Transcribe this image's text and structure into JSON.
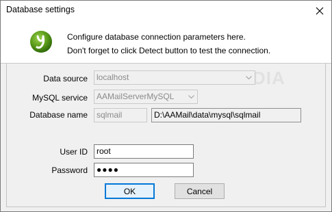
{
  "window": {
    "title": "Database settings"
  },
  "header": {
    "line1": "Configure database connection parameters here.",
    "line2": "Don't forget to click Detect button to test the connection."
  },
  "form": {
    "data_source_label": "Data source",
    "data_source_value": "localhost",
    "mysql_service_label": "MySQL service",
    "mysql_service_value": "AAMailServerMySQL",
    "database_name_label": "Database name",
    "database_name_value": "sqlmail",
    "database_path_value": "D:\\AAMail\\data\\mysql\\sqlmail",
    "user_id_label": "User ID",
    "user_id_value": "root",
    "password_label": "Password",
    "password_mask": "●●●●"
  },
  "buttons": {
    "ok_label": "OK",
    "cancel_label": "Cancel"
  },
  "watermark": "SOFTPEDIA",
  "colors": {
    "dialog_bg": "#f0f0f0",
    "logo_green": "#5a9a1a",
    "default_button_border": "#0078d7"
  }
}
